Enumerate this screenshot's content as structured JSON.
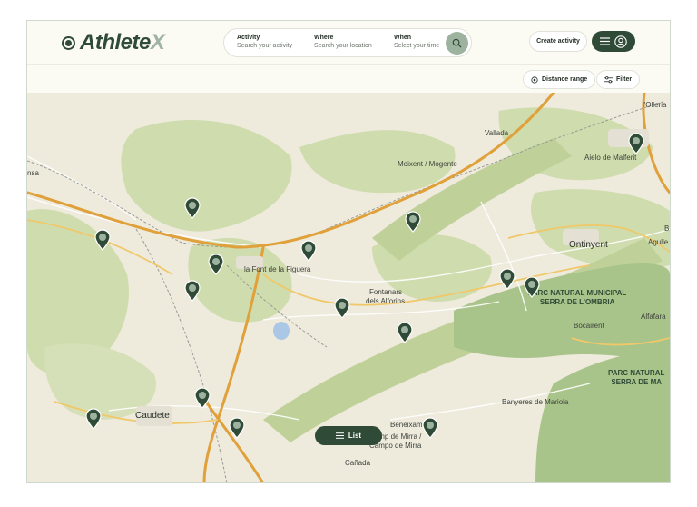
{
  "brand": {
    "name_main": "Athlete",
    "name_accent": "X"
  },
  "search": {
    "activity": {
      "title": "Activity",
      "placeholder": "Search your activity"
    },
    "where": {
      "title": "Where",
      "placeholder": "Search your location"
    },
    "when": {
      "title": "When",
      "placeholder": "Select your time"
    }
  },
  "header": {
    "create_label": "Create activity"
  },
  "filters": {
    "distance_label": "Distance range",
    "filter_label": "Filter"
  },
  "map": {
    "places": [
      {
        "name": "l'Olleria",
        "cls": ""
      },
      {
        "name": "Vallada",
        "cls": ""
      },
      {
        "name": "Moixent / Mogente",
        "cls": ""
      },
      {
        "name": "Aielo de Malferit",
        "cls": ""
      },
      {
        "name": "nsa",
        "cls": ""
      },
      {
        "name": "Ontinyent",
        "cls": "big"
      },
      {
        "name": "Agulle",
        "cls": ""
      },
      {
        "name": "B",
        "cls": ""
      },
      {
        "name": "la Font de la Figuera",
        "cls": ""
      },
      {
        "name": "Fontanars",
        "cls": ""
      },
      {
        "name": "dels Alforins",
        "cls": ""
      },
      {
        "name": "Alfafara",
        "cls": ""
      },
      {
        "name": "Bocairent",
        "cls": ""
      },
      {
        "name": "Caudete",
        "cls": "big"
      },
      {
        "name": "Banyeres de Mariola",
        "cls": ""
      },
      {
        "name": "Beneixama",
        "cls": ""
      },
      {
        "name": "Camp de Mirra /",
        "cls": ""
      },
      {
        "name": "Campo de Mirra",
        "cls": ""
      },
      {
        "name": "Cañada",
        "cls": ""
      }
    ],
    "parks": [
      {
        "line1": "PARC NATURAL MUNICIPAL",
        "line2": "SERRA DE L'OMBRIA"
      },
      {
        "line1": "PARC NATURAL",
        "line2": "SERRA DE MA"
      }
    ],
    "list_label": "List"
  },
  "colors": {
    "brand": "#2f4a36",
    "accent": "#9fb3a2",
    "road": "#e0a03a",
    "forest": "#c9d8a6"
  }
}
